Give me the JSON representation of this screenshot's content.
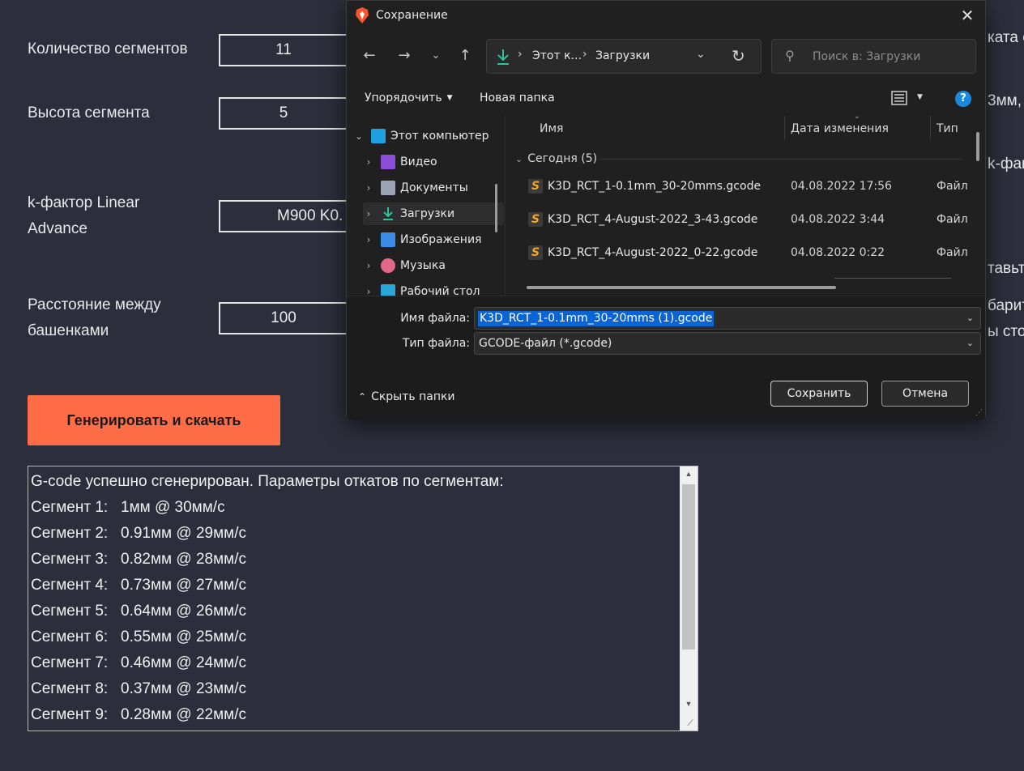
{
  "page": {
    "fields": [
      {
        "label": "Количество сегментов",
        "value": "11"
      },
      {
        "label": "Высота сегмента",
        "value": "5"
      },
      {
        "label_line1": "k-фактор Linear",
        "label_line2": "Advance",
        "value": "M900 K0."
      },
      {
        "label_line1": "Расстояние между",
        "label_line2": "башенками",
        "value": "100"
      }
    ],
    "generate_button": "Генерировать и скачать",
    "log": [
      "G-code успешно сгенерирован. Параметры откатов по сегментам:",
      "Сегмент 1:   1мм @ 30мм/с",
      "Сегмент 2:   0.91мм @ 29мм/с",
      "Сегмент 3:   0.82мм @ 28мм/с",
      "Сегмент 4:   0.73мм @ 27мм/с",
      "Сегмент 5:   0.64мм @ 26мм/с",
      "Сегмент 6:   0.55мм @ 25мм/с",
      "Сегмент 7:   0.46мм @ 24мм/с",
      "Сегмент 8:   0.37мм @ 23мм/с",
      "Сегмент 9:   0.28мм @ 22мм/с"
    ],
    "right_fragments": [
      "ката с",
      "3мм,",
      "k-фак",
      "тавьт",
      "барит",
      "ы сто"
    ]
  },
  "dialog": {
    "title": "Сохранение",
    "address": {
      "seg1": "Этот к...",
      "seg2": "Загрузки"
    },
    "search_placeholder": "Поиск в: Загрузки",
    "toolbar": {
      "organize": "Упорядочить",
      "new_folder": "Новая папка"
    },
    "tree": [
      {
        "label": "Этот компьютер",
        "icon": "pc-icon",
        "expanded": true
      },
      {
        "label": "Видео",
        "icon": "video-icon"
      },
      {
        "label": "Документы",
        "icon": "documents-icon"
      },
      {
        "label": "Загрузки",
        "icon": "downloads-icon",
        "selected": true
      },
      {
        "label": "Изображения",
        "icon": "pictures-icon"
      },
      {
        "label": "Музыка",
        "icon": "music-icon"
      },
      {
        "label": "Рабочий стол",
        "icon": "desktop-icon"
      }
    ],
    "columns": {
      "name": "Имя",
      "date": "Дата изменения",
      "type": "Тип"
    },
    "group": "Сегодня (5)",
    "files": [
      {
        "name": "K3D_RCT_1-0.1mm_30-20mms.gcode",
        "date": "04.08.2022 17:56",
        "type": "Файл"
      },
      {
        "name": "K3D_RCT_4-August-2022_3-43.gcode",
        "date": "04.08.2022 3:44",
        "type": "Файл"
      },
      {
        "name": "K3D_RCT_4-August-2022_0-22.gcode",
        "date": "04.08.2022 0:22",
        "type": "Файл"
      }
    ],
    "filename_label": "Имя файла:",
    "filename_value": "K3D_RCT_1-0.1mm_30-20mms (1).gcode",
    "filetype_label": "Тип файла:",
    "filetype_value": "GCODE-файл (*.gcode)",
    "hide_folders": "Скрыть папки",
    "save_button": "Сохранить",
    "cancel_button": "Отмена"
  },
  "colors": {
    "page_bg": "#2c2e3b",
    "accent_button": "#ff6d47",
    "dialog_bg": "#202020",
    "selection": "#0a64d6"
  }
}
